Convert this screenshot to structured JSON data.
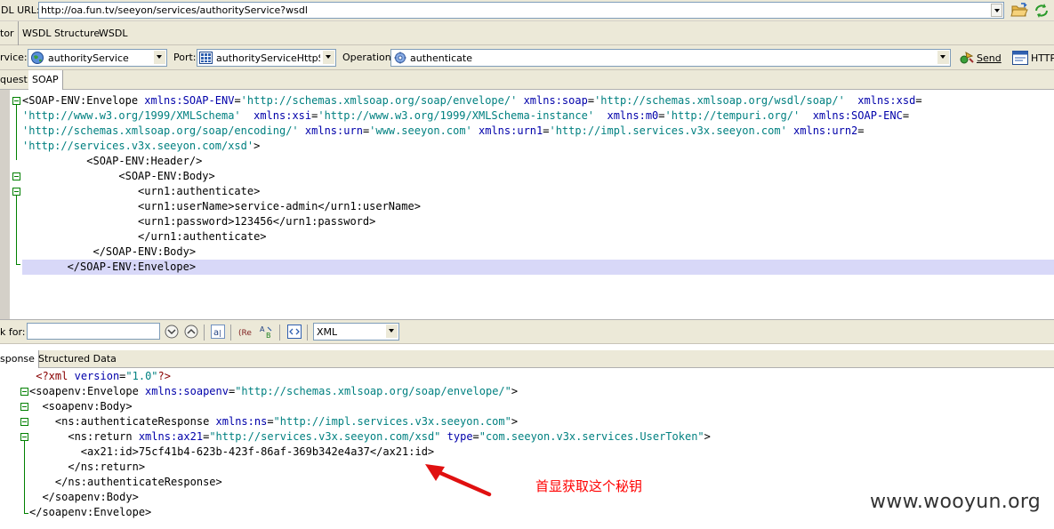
{
  "toolbar": {
    "url_label": "DL URL:",
    "url_value": "http://oa.fun.tv/seeyon/services/authorityService?wsdl"
  },
  "tabs": [
    "tor",
    "WSDL Structure",
    "WSDL"
  ],
  "service_row": {
    "service_label": "rvice:",
    "service_value": "authorityService",
    "port_label": "Port:",
    "port_value": "authorityServiceHttpSoa",
    "operation_label": "Operation:",
    "operation_value": "authenticate",
    "send_label": "Send",
    "http_label": "HTTP"
  },
  "request_tabs": [
    "quest",
    "SOAP"
  ],
  "request_lines": [
    [
      [
        "t",
        "<SOAP-ENV:Envelope "
      ],
      [
        "n",
        "xmlns:SOAP-ENV"
      ],
      [
        "t",
        "="
      ],
      [
        "s",
        "'http://schemas.xmlsoap.org/soap/envelope/'"
      ],
      [
        "t",
        " "
      ],
      [
        "n",
        "xmlns:soap"
      ],
      [
        "t",
        "="
      ],
      [
        "s",
        "'http://schemas.xmlsoap.org/wsdl/soap/'"
      ],
      [
        "t",
        "  "
      ],
      [
        "n",
        "xmlns:xsd"
      ],
      [
        "t",
        "="
      ]
    ],
    [
      [
        "s",
        "'http://www.w3.org/1999/XMLSchema'"
      ],
      [
        "t",
        "  "
      ],
      [
        "n",
        "xmlns:xsi"
      ],
      [
        "t",
        "="
      ],
      [
        "s",
        "'http://www.w3.org/1999/XMLSchema-instance'"
      ],
      [
        "t",
        "  "
      ],
      [
        "n",
        "xmlns:m0"
      ],
      [
        "t",
        "="
      ],
      [
        "s",
        "'http://tempuri.org/'"
      ],
      [
        "t",
        "  "
      ],
      [
        "n",
        "xmlns:SOAP-ENC"
      ],
      [
        "t",
        "="
      ]
    ],
    [
      [
        "s",
        "'http://schemas.xmlsoap.org/soap/encoding/'"
      ],
      [
        "t",
        " "
      ],
      [
        "n",
        "xmlns:urn"
      ],
      [
        "t",
        "="
      ],
      [
        "s",
        "'www.seeyon.com'"
      ],
      [
        "t",
        " "
      ],
      [
        "n",
        "xmlns:urn1"
      ],
      [
        "t",
        "="
      ],
      [
        "s",
        "'http://impl.services.v3x.seeyon.com'"
      ],
      [
        "t",
        " "
      ],
      [
        "n",
        "xmlns:urn2"
      ],
      [
        "t",
        "="
      ]
    ],
    [
      [
        "s",
        "'http://services.v3x.seeyon.com/xsd'"
      ],
      [
        "t",
        ">"
      ]
    ],
    [
      [
        "t",
        "          <SOAP-ENV:Header/>"
      ]
    ],
    [
      [
        "t",
        "               <SOAP-ENV:Body>"
      ]
    ],
    [
      [
        "t",
        "                  <urn1:authenticate>"
      ]
    ],
    [
      [
        "t",
        "                  <urn1:userName>service-admin</urn1:userName>"
      ]
    ],
    [
      [
        "t",
        "                  <urn1:password>123456</urn1:password>"
      ]
    ],
    [
      [
        "t",
        "                  </urn1:authenticate>"
      ]
    ],
    [
      [
        "t",
        "           </SOAP-ENV:Body>"
      ]
    ],
    [
      [
        "t",
        "       </SOAP-ENV:Envelope>"
      ]
    ]
  ],
  "find_row": {
    "label": "k for:",
    "format_value": "XML"
  },
  "response_tabs": [
    "sponse",
    "Structured Data"
  ],
  "response_lines": [
    [
      [
        "t",
        " "
      ],
      [
        "r",
        "<?xml "
      ],
      [
        "n",
        "version"
      ],
      [
        "t",
        "="
      ],
      [
        "s",
        "\"1.0\""
      ],
      [
        "r",
        "?>"
      ]
    ],
    [
      [
        "t",
        "<soapenv:Envelope "
      ],
      [
        "n",
        "xmlns:soapenv"
      ],
      [
        "t",
        "="
      ],
      [
        "s",
        "\"http://schemas.xmlsoap.org/soap/envelope/\""
      ],
      [
        "t",
        ">"
      ]
    ],
    [
      [
        "t",
        "  <soapenv:Body>"
      ]
    ],
    [
      [
        "t",
        "    <ns:authenticateResponse "
      ],
      [
        "n",
        "xmlns:ns"
      ],
      [
        "t",
        "="
      ],
      [
        "s",
        "\"http://impl.services.v3x.seeyon.com\""
      ],
      [
        "t",
        ">"
      ]
    ],
    [
      [
        "t",
        "      <ns:return "
      ],
      [
        "n",
        "xmlns:ax21"
      ],
      [
        "t",
        "="
      ],
      [
        "s",
        "\"http://services.v3x.seeyon.com/xsd\""
      ],
      [
        "t",
        " "
      ],
      [
        "n",
        "type"
      ],
      [
        "t",
        "="
      ],
      [
        "s",
        "\"com.seeyon.v3x.services.UserToken\""
      ],
      [
        "t",
        ">"
      ]
    ],
    [
      [
        "t",
        "        <ax21:id>75cf41b4-623b-423f-86af-369b342e4a37</ax21:id>"
      ]
    ],
    [
      [
        "t",
        "      </ns:return>"
      ]
    ],
    [
      [
        "t",
        "    </ns:authenticateResponse>"
      ]
    ],
    [
      [
        "t",
        "  </soapenv:Body>"
      ]
    ],
    [
      [
        "t",
        "</soapenv:Envelope>"
      ]
    ]
  ],
  "annotation_text": "首显获取这个秘钥",
  "watermark_text": "www.wooyun.org",
  "colors": {
    "toolbar_bg": "#ece9d8",
    "tag": "#000000",
    "attr_name": "#0000aa",
    "attr_value": "#008080",
    "fold_marker": "#008000",
    "line_highlight": "#d8d8f8",
    "annotation": "#ff0000"
  }
}
